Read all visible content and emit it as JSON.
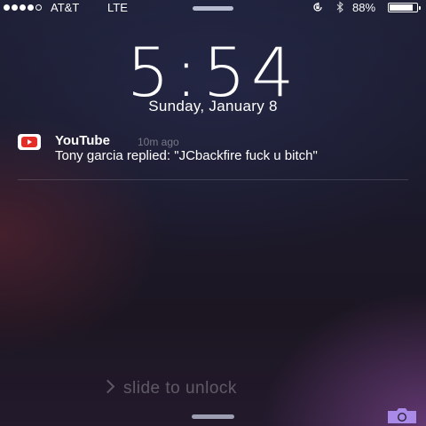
{
  "status_bar": {
    "signal_filled": 4,
    "signal_total": 5,
    "carrier": "AT&T",
    "network": "LTE",
    "orientation_lock_icon": "orientation-lock-icon",
    "bluetooth_icon": "bluetooth-icon",
    "battery_percent": "88%",
    "battery_level": 0.88
  },
  "lock_screen": {
    "time": "5:54",
    "date": "Sunday, January 8"
  },
  "notification": {
    "app_icon": "youtube-icon",
    "app_name": "YouTube",
    "time_ago": "10m ago",
    "message": "Tony garcia replied: \"JCbackfire fuck u bitch\""
  },
  "unlock": {
    "label": "slide to unlock",
    "camera_icon": "camera-icon"
  },
  "colors": {
    "youtube_red": "#e52d27",
    "camera_purple": "#a98ae8"
  }
}
